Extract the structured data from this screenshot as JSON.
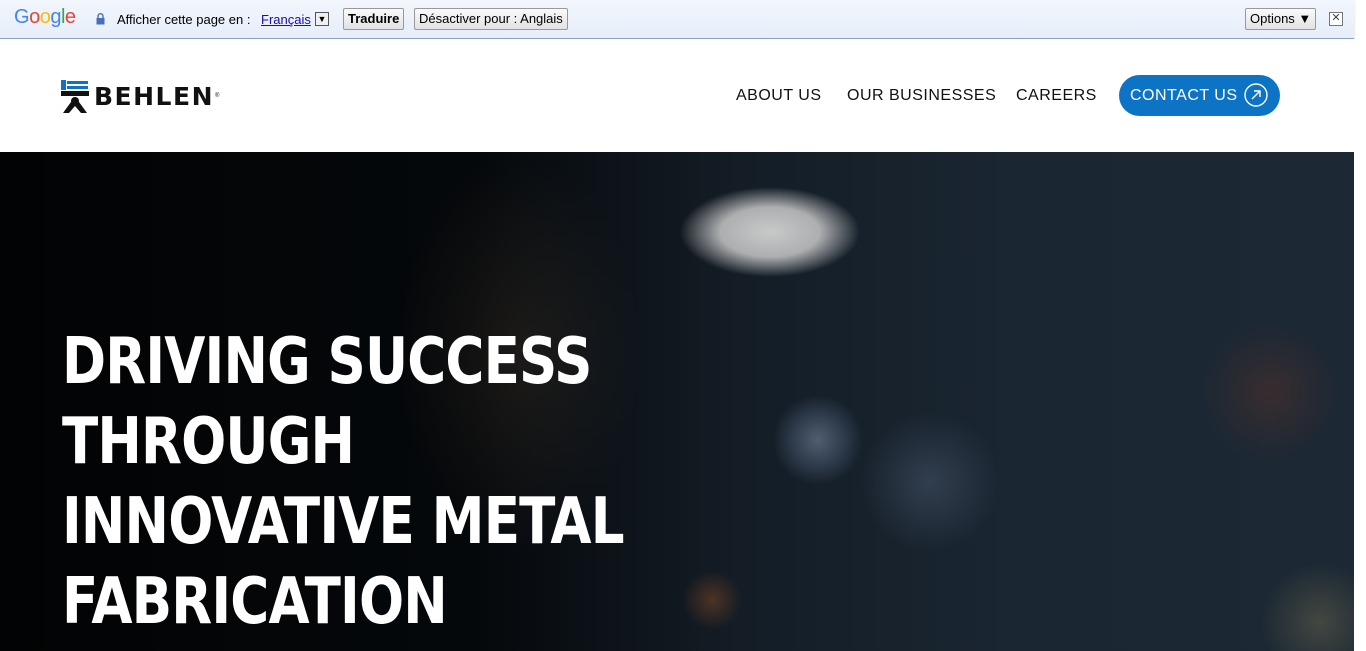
{
  "translate_bar": {
    "logo_text": "Google",
    "prompt": "Afficher cette page en :",
    "language": "Français",
    "language_dropdown_glyph": "▼",
    "translate_button": "Traduire",
    "disable_button": "Désactiver pour : Anglais",
    "options_button": "Options ▼",
    "close_glyph": "✕"
  },
  "header": {
    "logo_text": "BEHLEN",
    "logo_registered": "®",
    "nav": {
      "about": "ABOUT US",
      "businesses": "OUR BUSINESSES",
      "careers": "CAREERS"
    },
    "contact_button": "CONTACT US",
    "colors": {
      "brand_blue": "#0d73c5",
      "text": "#111111"
    }
  },
  "hero": {
    "title_lines": [
      "DRIVING SUCCESS",
      "THROUGH",
      "INNOVATIVE METAL",
      "FABRICATION"
    ],
    "background": "dark bokeh industrial photo"
  },
  "icons": {
    "lock": "lock-icon",
    "contact_arrow": "arrow-up-right-circle-icon",
    "logo_mark": "behlen-logo-mark-icon"
  }
}
